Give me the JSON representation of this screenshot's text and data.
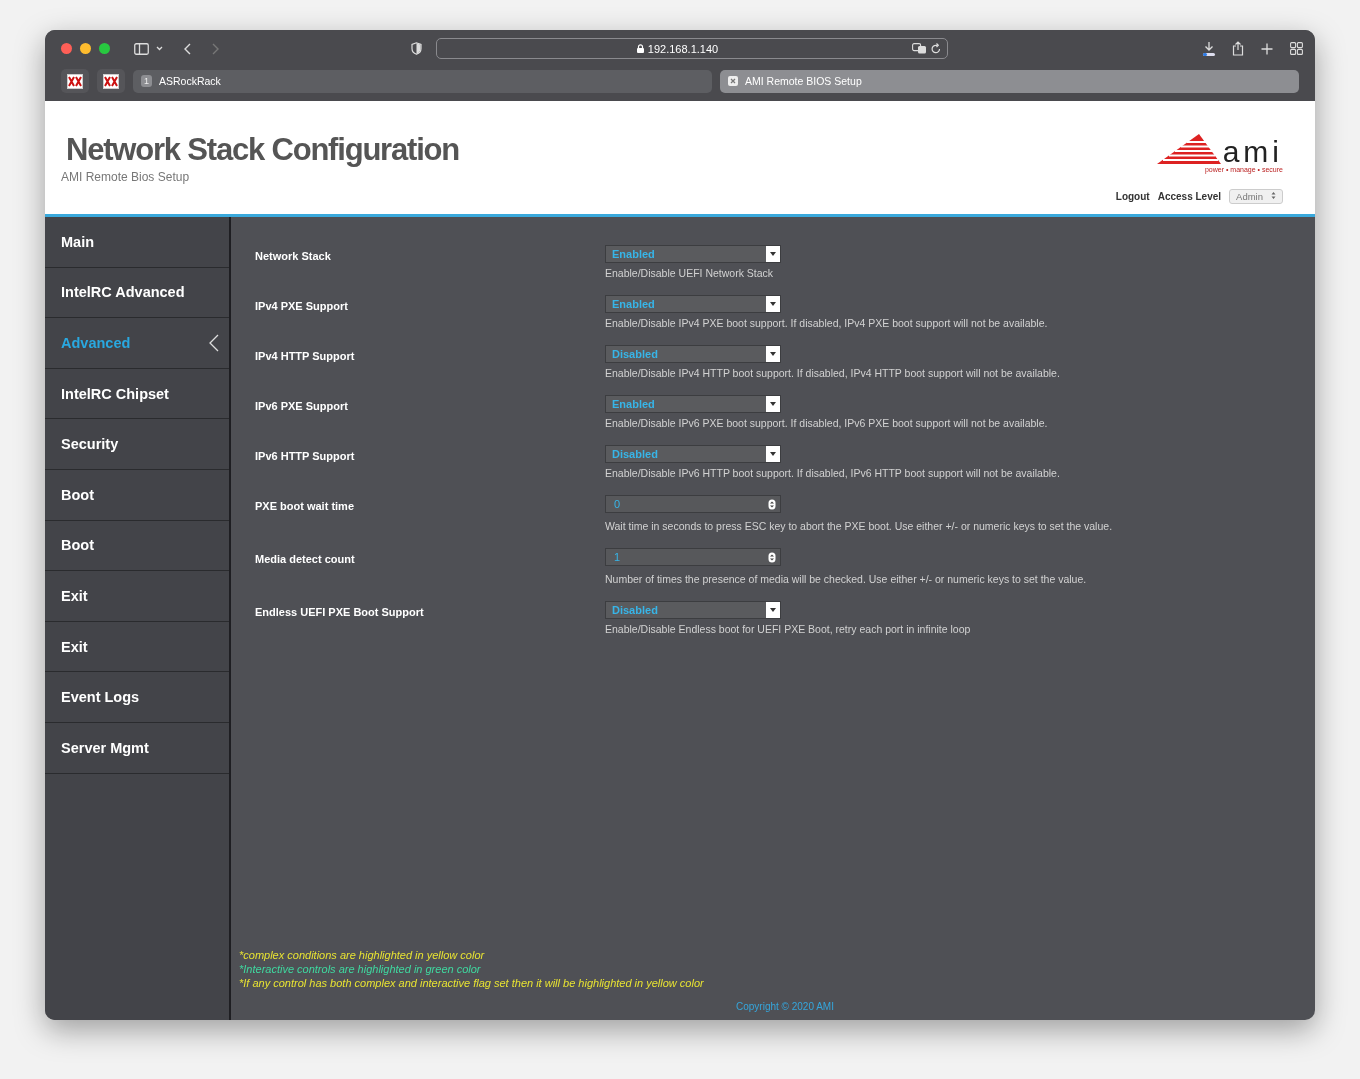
{
  "browser": {
    "url": "192.168.1.140",
    "tabs": [
      {
        "kind": "pinned",
        "selected": false
      },
      {
        "kind": "pinned",
        "selected": false
      },
      {
        "kind": "tab",
        "badge": "1",
        "title": "ASRockRack",
        "selected": false
      },
      {
        "kind": "tab",
        "title": "AMI Remote BIOS Setup",
        "selected": true
      }
    ]
  },
  "header": {
    "title": "Network Stack Configuration",
    "subtitle": "AMI Remote Bios Setup",
    "logo": {
      "wordmark": "ami",
      "tagline": "power • manage • secure"
    },
    "logout": "Logout",
    "access_level_label": "Access Level",
    "access_level": "Admin"
  },
  "sidebar": {
    "items": [
      {
        "label": "Main",
        "selected": false
      },
      {
        "label": "IntelRC Advanced",
        "selected": false
      },
      {
        "label": "Advanced",
        "selected": true
      },
      {
        "label": "IntelRC Chipset",
        "selected": false
      },
      {
        "label": "Security",
        "selected": false
      },
      {
        "label": "Boot",
        "selected": false
      },
      {
        "label": "Boot",
        "selected": false
      },
      {
        "label": "Exit",
        "selected": false
      },
      {
        "label": "Exit",
        "selected": false
      },
      {
        "label": "Event Logs",
        "selected": false
      },
      {
        "label": "Server Mgmt",
        "selected": false
      }
    ]
  },
  "settings": [
    {
      "kind": "select",
      "label": "Network Stack",
      "value": "Enabled",
      "help": "Enable/Disable UEFI Network Stack"
    },
    {
      "kind": "select",
      "label": "IPv4 PXE Support",
      "value": "Enabled",
      "help": "Enable/Disable IPv4 PXE boot support. If disabled, IPv4 PXE boot support will not be available."
    },
    {
      "kind": "select",
      "label": "IPv4 HTTP Support",
      "value": "Disabled",
      "help": "Enable/Disable IPv4 HTTP boot support. If disabled, IPv4 HTTP boot support will not be available."
    },
    {
      "kind": "select",
      "label": "IPv6 PXE Support",
      "value": "Enabled",
      "help": "Enable/Disable IPv6 PXE boot support. If disabled, IPv6 PXE boot support will not be available."
    },
    {
      "kind": "select",
      "label": "IPv6 HTTP Support",
      "value": "Disabled",
      "help": "Enable/Disable IPv6 HTTP boot support. If disabled, IPv6 HTTP boot support will not be available."
    },
    {
      "kind": "number",
      "label": "PXE boot wait time",
      "value": "0",
      "help": "Wait time in seconds to press ESC key to abort the PXE boot. Use either +/- or numeric keys to set the value."
    },
    {
      "kind": "number",
      "label": "Media detect count",
      "value": "1",
      "help": "Number of times the presence of media will be checked. Use either +/- or numeric keys to set the value."
    },
    {
      "kind": "select",
      "label": "Endless UEFI PXE Boot Support",
      "value": "Disabled",
      "help": "Enable/Disable Endless boot for UEFI PXE Boot, retry each port in infinite loop"
    }
  ],
  "notes": [
    {
      "text": "*complex conditions are highlighted in yellow color",
      "color": "#e8e332"
    },
    {
      "text": "*Interactive controls are highlighted in green color",
      "color": "#3fd9a0"
    },
    {
      "text": "*If any control has both complex and interactive flag set then it will be highlighted in yellow color",
      "color": "#e8e332"
    }
  ],
  "copyright": "Copyright © 2020 AMI"
}
